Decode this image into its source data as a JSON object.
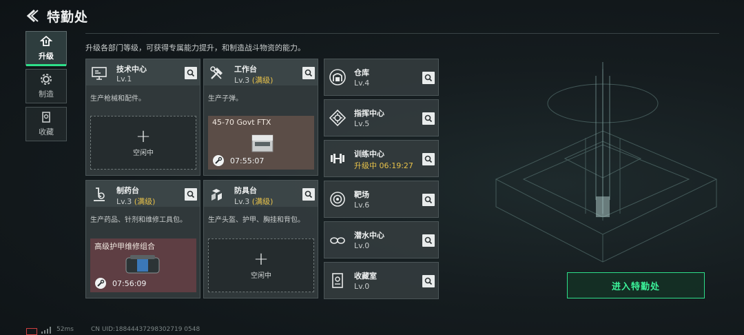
{
  "header": {
    "title": "特勤处"
  },
  "subtitle": "升级各部门等级，可获得专属能力提升，和制造战斗物资的能力。",
  "tabs": [
    {
      "label": "升级",
      "active": true,
      "icon": "upgrade-icon"
    },
    {
      "label": "制造",
      "active": false,
      "icon": "craft-gear-icon"
    },
    {
      "label": "收藏",
      "active": false,
      "icon": "collection-icon"
    }
  ],
  "facilities": [
    {
      "name": "技术中心",
      "level": "Lv.1",
      "max": "",
      "desc": "生产枪械和配件。",
      "icon": "tech-center-icon",
      "slot": {
        "state": "idle",
        "plus": "+",
        "label": "空闲中"
      }
    },
    {
      "name": "工作台",
      "level": "Lv.3",
      "max": "(满级)",
      "desc": "生产子弹。",
      "icon": "workbench-icon",
      "slot": {
        "state": "producing",
        "item": "45-70 Govt FTX",
        "timer": "07:55:07"
      }
    },
    {
      "name": "制药台",
      "level": "Lv.3",
      "max": "(满级)",
      "desc": "生产药品、针剂和维修工具包。",
      "icon": "pharmacy-icon",
      "slot": {
        "state": "producing",
        "item": "高级护甲维修组合",
        "timer": "07:56:09"
      }
    },
    {
      "name": "防具台",
      "level": "Lv.3",
      "max": "(满级)",
      "desc": "生产头盔、护甲、胸挂和背包。",
      "icon": "armor-bench-icon",
      "slot": {
        "state": "idle",
        "plus": "+",
        "label": "空闲中"
      }
    }
  ],
  "rooms": [
    {
      "name": "仓库",
      "level": "Lv.4",
      "icon": "warehouse-icon"
    },
    {
      "name": "指挥中心",
      "level": "Lv.5",
      "icon": "command-center-icon"
    },
    {
      "name": "训练中心",
      "level": "升级中 06:19:27",
      "icon": "dumbbell-icon",
      "upgrading": true
    },
    {
      "name": "靶场",
      "level": "Lv.6",
      "icon": "target-icon"
    },
    {
      "name": "潜水中心",
      "level": "Lv.0",
      "icon": "diving-goggles-icon"
    },
    {
      "name": "收藏室",
      "level": "Lv.0",
      "icon": "collection-room-icon"
    }
  ],
  "enter_button": "进入特勤处",
  "footer": {
    "ping": "52ms",
    "uid": "CN UID:18844437298302719 0548"
  },
  "colors": {
    "accent": "#2ee08a",
    "max_level": "#e8c24a"
  }
}
